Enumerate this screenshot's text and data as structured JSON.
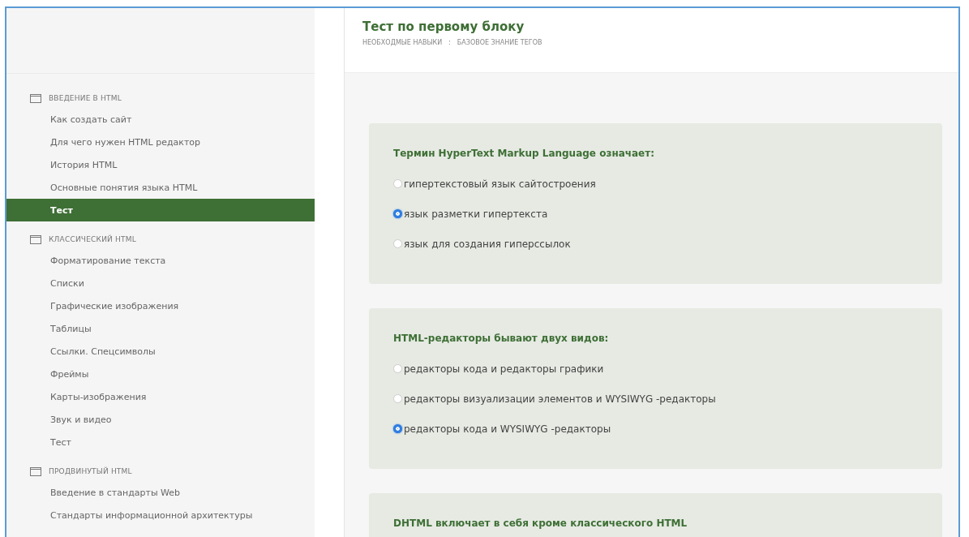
{
  "sidebar": {
    "groups": [
      {
        "title": "ВВЕДЕНИЕ В HTML",
        "items": [
          {
            "label": "Как создать сайт",
            "selected": false
          },
          {
            "label": "Для чего нужен HTML редактор",
            "selected": false
          },
          {
            "label": "История HTML",
            "selected": false
          },
          {
            "label": "Основные понятия языка HTML",
            "selected": false
          },
          {
            "label": "Тест",
            "selected": true
          }
        ]
      },
      {
        "title": "КЛАССИЧЕСКИЙ HTML",
        "items": [
          {
            "label": "Форматирование текста",
            "selected": false
          },
          {
            "label": "Списки",
            "selected": false
          },
          {
            "label": "Графические изображения",
            "selected": false
          },
          {
            "label": "Таблицы",
            "selected": false
          },
          {
            "label": "Ссылки. Спецсимволы",
            "selected": false
          },
          {
            "label": "Фреймы",
            "selected": false
          },
          {
            "label": "Карты-изображения",
            "selected": false
          },
          {
            "label": "Звук и видео",
            "selected": false
          },
          {
            "label": "Тест",
            "selected": false
          }
        ]
      },
      {
        "title": "ПРОДВИНУТЫЙ HTML",
        "items": [
          {
            "label": "Введение в стандарты Web",
            "selected": false
          },
          {
            "label": "Стандарты информационной архитектуры",
            "selected": false
          }
        ]
      }
    ]
  },
  "header": {
    "title": "Тест по первому блоку",
    "breadcrumb": [
      "НЕОБХОДМЫЕ НАВЫКИ",
      ":",
      "БАЗОВОЕ ЗНАНИЕ ТЕГОВ"
    ]
  },
  "questions": [
    {
      "text": "Термин HyperText Markup Language означает:",
      "options": [
        {
          "label": "гипертекстовый язык сайтостроения",
          "selected": false
        },
        {
          "label": "язык разметки гипертекста",
          "selected": true
        },
        {
          "label": "язык для создания гиперссылок",
          "selected": false
        }
      ]
    },
    {
      "text": "HTML-редакторы бывают двух видов:",
      "options": [
        {
          "label": "редакторы кода и редакторы графики",
          "selected": false
        },
        {
          "label": "редакторы визуализации элементов и WYSIWYG -редакторы",
          "selected": false
        },
        {
          "label": "редакторы кода и WYSIWYG -редакторы",
          "selected": true
        }
      ]
    },
    {
      "text": "DHTML включает в себя кроме классического HTML"
    }
  ]
}
